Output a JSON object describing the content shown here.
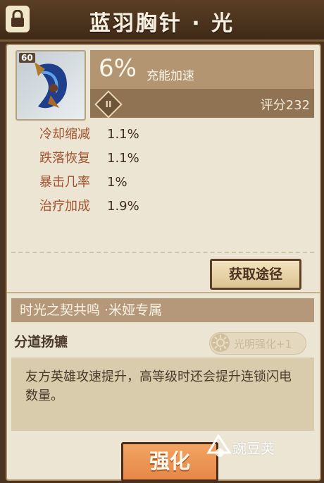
{
  "header": {
    "title": "蓝羽胸针 · 光"
  },
  "item": {
    "level": "60",
    "main_stat_value": "6%",
    "main_stat_label": "充能加速",
    "tier": "II",
    "score": "评分232"
  },
  "stats": [
    {
      "name": "冷却缩减",
      "value": "1.1%"
    },
    {
      "name": "跌落恢复",
      "value": "1.1%"
    },
    {
      "name": "暴击几率",
      "value": "1%"
    },
    {
      "name": "治疗加成",
      "value": "1.9%"
    }
  ],
  "buttons": {
    "source_label": "获取途径",
    "upgrade_label": "强化"
  },
  "set": {
    "title": "时光之契共鸣 ·米娅专属",
    "skill_name": "分道扬镳",
    "badge": "光明强化+1",
    "description": "友方英雄攻速提升，高等级时还会提升连锁闪电数量。"
  },
  "watermark": {
    "text": "豌豆荚"
  },
  "colors": {
    "stat_name": "#a0522d",
    "upgrade_button": "#e58747"
  }
}
